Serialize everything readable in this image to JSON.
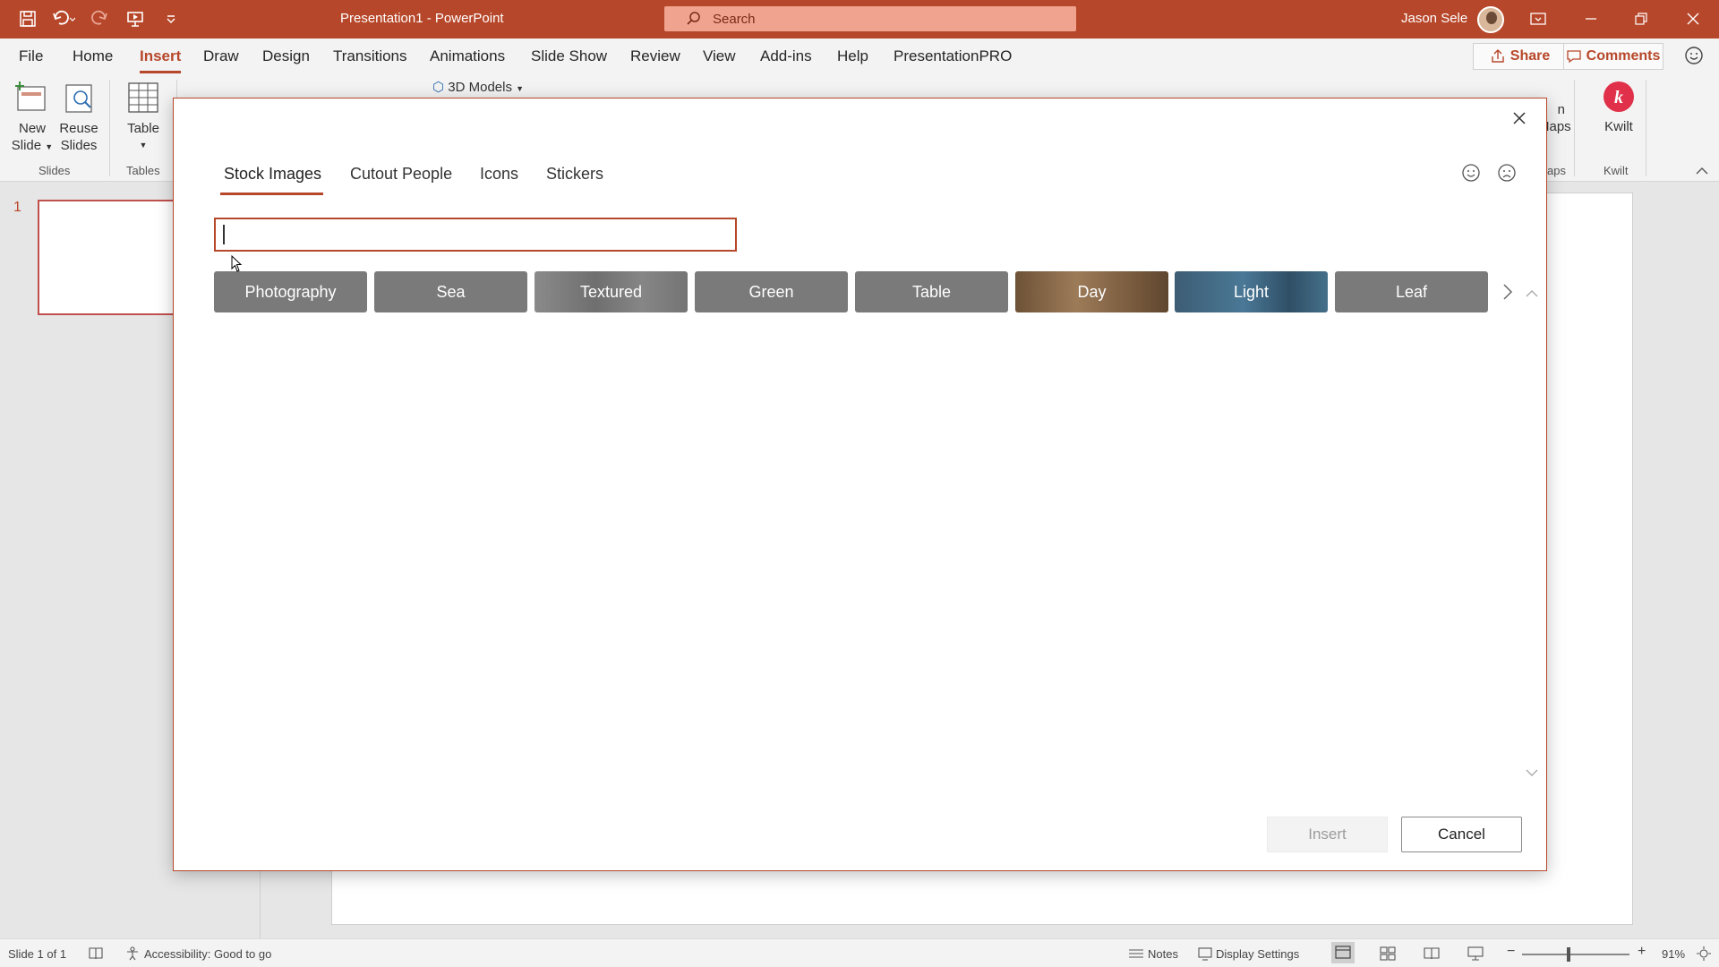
{
  "titlebar": {
    "doc_title": "Presentation1  -  PowerPoint",
    "search_placeholder": "Search",
    "user_name": "Jason Sele",
    "bg_color": "#b7472a"
  },
  "menu": {
    "items": [
      "File",
      "Home",
      "Insert",
      "Draw",
      "Design",
      "Transitions",
      "Animations",
      "Slide Show",
      "Review",
      "View",
      "Add-ins",
      "Help",
      "PresentationPRO"
    ],
    "active": "Insert",
    "share_label": "Share",
    "comments_label": "Comments"
  },
  "ribbon": {
    "new_slide_label": "New\nSlide",
    "new_slide_line1": "New",
    "new_slide_line2": "Slide",
    "reuse_line1": "Reuse",
    "reuse_line2": "Slides",
    "table_label": "Table",
    "models_label": "3D Models",
    "slides_group": "Slides",
    "tables_group": "Tables",
    "maps_partial_1": "n",
    "maps_partial_2": "Maps",
    "maps_group_partial": "aps",
    "kwilt_label": "Kwilt",
    "kwilt_group": "Kwilt"
  },
  "slides_pane": {
    "slide_number": "1"
  },
  "dialog": {
    "tabs": [
      "Stock Images",
      "Cutout People",
      "Icons",
      "Stickers"
    ],
    "active_tab": "Stock Images",
    "search_value": "",
    "chips": [
      "Photography",
      "Sea",
      "Textured",
      "Green",
      "Table",
      "Day",
      "Light",
      "Leaf"
    ],
    "insert_label": "Insert",
    "cancel_label": "Cancel"
  },
  "statusbar": {
    "slide_info": "Slide 1 of 1",
    "accessibility": "Accessibility: Good to go",
    "notes_label": "Notes",
    "display_settings_label": "Display Settings",
    "zoom_level": "91%"
  },
  "colors": {
    "accent": "#b7472a",
    "chip_gray": "#7a7a7a"
  }
}
